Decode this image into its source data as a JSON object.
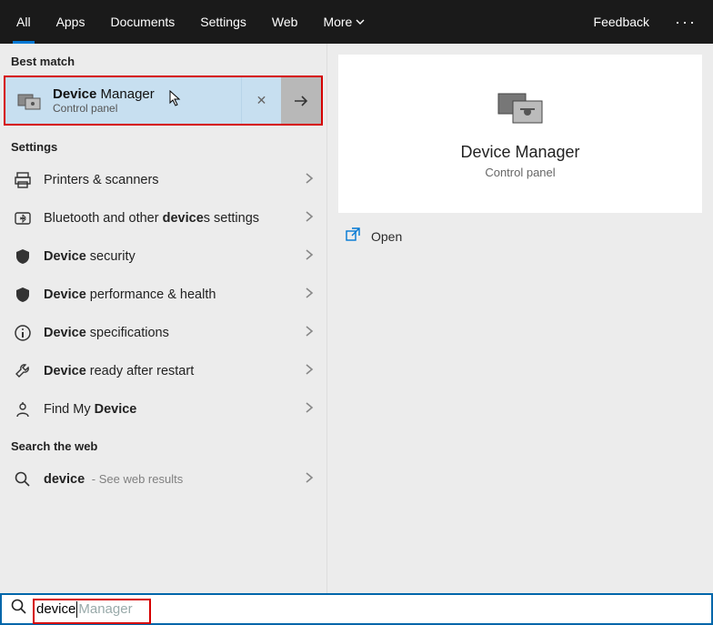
{
  "tabs": {
    "all": "All",
    "apps": "Apps",
    "documents": "Documents",
    "settings": "Settings",
    "web": "Web",
    "more": "More",
    "feedback": "Feedback"
  },
  "sections": {
    "best_match": "Best match",
    "settings": "Settings",
    "search_web": "Search the web"
  },
  "best": {
    "title_bold": "Device",
    "title_rest": " Manager",
    "subtitle": "Control panel"
  },
  "settings_items": [
    {
      "icon": "printer",
      "pre": "",
      "bold": "",
      "post": "Printers & scanners"
    },
    {
      "icon": "bluetooth",
      "pre": "Bluetooth and other ",
      "bold": "device",
      "post": "s settings"
    },
    {
      "icon": "shield",
      "pre": "",
      "bold": "Device",
      "post": " security"
    },
    {
      "icon": "shield",
      "pre": "",
      "bold": "Device",
      "post": " performance & health"
    },
    {
      "icon": "info",
      "pre": "",
      "bold": "Device",
      "post": " specifications"
    },
    {
      "icon": "wrench",
      "pre": "",
      "bold": "Device",
      "post": " ready after restart"
    },
    {
      "icon": "findmy",
      "pre": "Find My ",
      "bold": "Device",
      "post": ""
    }
  ],
  "web_item": {
    "query_bold": "device",
    "suffix": " - See web results"
  },
  "preview": {
    "title": "Device Manager",
    "subtitle": "Control panel",
    "open": "Open"
  },
  "search": {
    "typed": "device",
    "autocomplete": " Manager"
  }
}
